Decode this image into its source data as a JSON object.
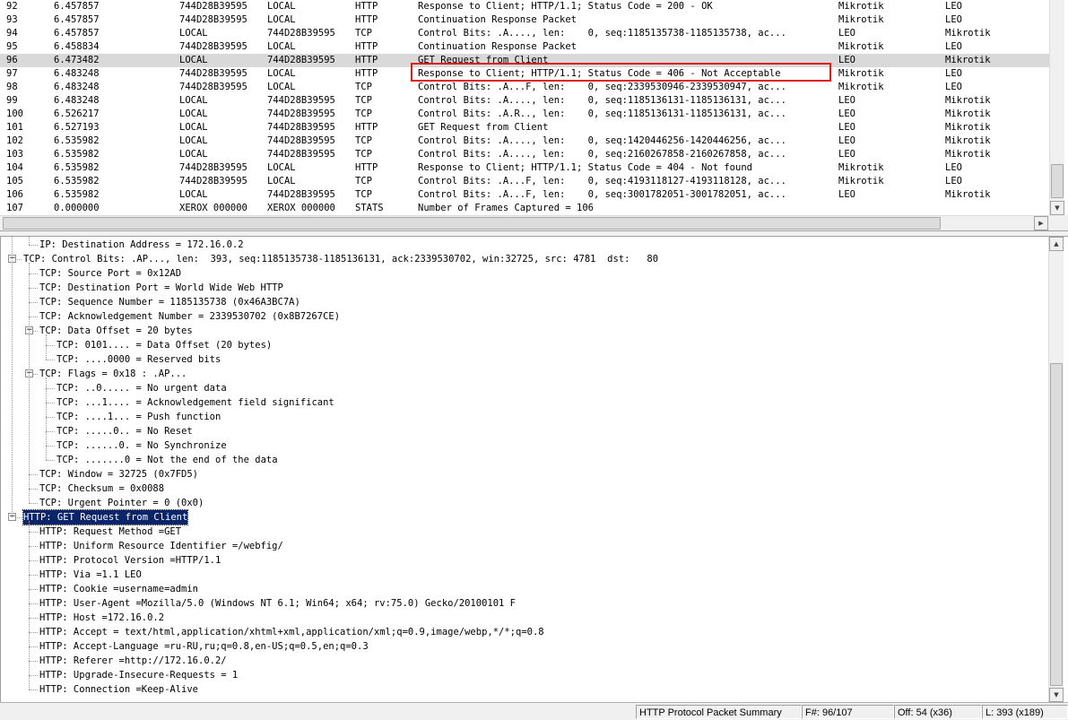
{
  "packets": [
    {
      "num": "92",
      "time": "6.457857",
      "src": "744D28B39595",
      "dst": "LOCAL",
      "protocol": "HTTP",
      "description": "Response to Client; HTTP/1.1; Status Code = 200 - OK",
      "src_other": "Mikrotik",
      "dst_other": "LEO"
    },
    {
      "num": "93",
      "time": "6.457857",
      "src": "744D28B39595",
      "dst": "LOCAL",
      "protocol": "HTTP",
      "description": "Continuation Response Packet",
      "src_other": "Mikrotik",
      "dst_other": "LEO"
    },
    {
      "num": "94",
      "time": "6.457857",
      "src": "LOCAL",
      "dst": "744D28B39595",
      "protocol": "TCP",
      "description": "Control Bits: .A...., len:    0, seq:1185135738-1185135738, ac...",
      "src_other": "LEO",
      "dst_other": "Mikrotik"
    },
    {
      "num": "95",
      "time": "6.458834",
      "src": "744D28B39595",
      "dst": "LOCAL",
      "protocol": "HTTP",
      "description": "Continuation Response Packet",
      "src_other": "Mikrotik",
      "dst_other": "LEO"
    },
    {
      "num": "96",
      "time": "6.473482",
      "src": "LOCAL",
      "dst": "744D28B39595",
      "protocol": "HTTP",
      "description": "GET Request from Client",
      "src_other": "LEO",
      "dst_other": "Mikrotik",
      "selected": true
    },
    {
      "num": "97",
      "time": "6.483248",
      "src": "744D28B39595",
      "dst": "LOCAL",
      "protocol": "HTTP",
      "description": "Response to Client; HTTP/1.1; Status Code = 406 - Not Acceptable",
      "src_other": "Mikrotik",
      "dst_other": "LEO"
    },
    {
      "num": "98",
      "time": "6.483248",
      "src": "744D28B39595",
      "dst": "LOCAL",
      "protocol": "TCP",
      "description": "Control Bits: .A...F, len:    0, seq:2339530946-2339530947, ac...",
      "src_other": "Mikrotik",
      "dst_other": "LEO"
    },
    {
      "num": "99",
      "time": "6.483248",
      "src": "LOCAL",
      "dst": "744D28B39595",
      "protocol": "TCP",
      "description": "Control Bits: .A...., len:    0, seq:1185136131-1185136131, ac...",
      "src_other": "LEO",
      "dst_other": "Mikrotik"
    },
    {
      "num": "100",
      "time": "6.526217",
      "src": "LOCAL",
      "dst": "744D28B39595",
      "protocol": "TCP",
      "description": "Control Bits: .A.R.., len:    0, seq:1185136131-1185136131, ac...",
      "src_other": "LEO",
      "dst_other": "Mikrotik"
    },
    {
      "num": "101",
      "time": "6.527193",
      "src": "LOCAL",
      "dst": "744D28B39595",
      "protocol": "HTTP",
      "description": "GET Request from Client",
      "src_other": "LEO",
      "dst_other": "Mikrotik"
    },
    {
      "num": "102",
      "time": "6.535982",
      "src": "LOCAL",
      "dst": "744D28B39595",
      "protocol": "TCP",
      "description": "Control Bits: .A...., len:    0, seq:1420446256-1420446256, ac...",
      "src_other": "LEO",
      "dst_other": "Mikrotik"
    },
    {
      "num": "103",
      "time": "6.535982",
      "src": "LOCAL",
      "dst": "744D28B39595",
      "protocol": "TCP",
      "description": "Control Bits: .A...., len:    0, seq:2160267858-2160267858, ac...",
      "src_other": "LEO",
      "dst_other": "Mikrotik"
    },
    {
      "num": "104",
      "time": "6.535982",
      "src": "744D28B39595",
      "dst": "LOCAL",
      "protocol": "HTTP",
      "description": "Response to Client; HTTP/1.1; Status Code = 404 - Not found",
      "src_other": "Mikrotik",
      "dst_other": "LEO"
    },
    {
      "num": "105",
      "time": "6.535982",
      "src": "744D28B39595",
      "dst": "LOCAL",
      "protocol": "TCP",
      "description": "Control Bits: .A...F, len:    0, seq:4193118127-4193118128, ac...",
      "src_other": "Mikrotik",
      "dst_other": "LEO"
    },
    {
      "num": "106",
      "time": "6.535982",
      "src": "LOCAL",
      "dst": "744D28B39595",
      "protocol": "TCP",
      "description": "Control Bits: .A...F, len:    0, seq:3001782051-3001782051, ac...",
      "src_other": "LEO",
      "dst_other": "Mikrotik"
    },
    {
      "num": "107",
      "time": "0.000000",
      "src": "XEROX 000000",
      "dst": "XEROX 000000",
      "protocol": "STATS",
      "description": "Number of Frames Captured = 106",
      "src_other": "",
      "dst_other": ""
    }
  ],
  "details": [
    {
      "level": 1,
      "text": "IP: Destination Address = 172.16.0.2",
      "expander": "none"
    },
    {
      "level": 0,
      "text": "TCP: Control Bits: .AP..., len:  393, seq:1185135738-1185136131, ack:2339530702, win:32725, src: 4781  dst:   80",
      "expander": "minus"
    },
    {
      "level": 1,
      "text": "TCP: Source Port = 0x12AD",
      "expander": "none"
    },
    {
      "level": 1,
      "text": "TCP: Destination Port = World Wide Web HTTP",
      "expander": "none"
    },
    {
      "level": 1,
      "text": "TCP: Sequence Number = 1185135738 (0x46A3BC7A)",
      "expander": "none"
    },
    {
      "level": 1,
      "text": "TCP: Acknowledgement Number = 2339530702 (0x8B7267CE)",
      "expander": "none"
    },
    {
      "level": 1,
      "text": "TCP: Data Offset = 20 bytes",
      "expander": "minus"
    },
    {
      "level": 2,
      "text": "TCP: 0101.... = Data Offset (20 bytes)",
      "expander": "none"
    },
    {
      "level": 2,
      "text": "TCP: ....0000 = Reserved bits",
      "expander": "none"
    },
    {
      "level": 1,
      "text": "TCP: Flags = 0x18 : .AP...",
      "expander": "minus"
    },
    {
      "level": 2,
      "text": "TCP: ..0..... = No urgent data",
      "expander": "none"
    },
    {
      "level": 2,
      "text": "TCP: ...1.... = Acknowledgement field significant",
      "expander": "none"
    },
    {
      "level": 2,
      "text": "TCP: ....1... = Push function",
      "expander": "none"
    },
    {
      "level": 2,
      "text": "TCP: .....0.. = No Reset",
      "expander": "none"
    },
    {
      "level": 2,
      "text": "TCP: ......0. = No Synchronize",
      "expander": "none"
    },
    {
      "level": 2,
      "text": "TCP: .......0 = Not the end of the data",
      "expander": "none"
    },
    {
      "level": 1,
      "text": "TCP: Window = 32725 (0x7FD5)",
      "expander": "none"
    },
    {
      "level": 1,
      "text": "TCP: Checksum = 0x0088",
      "expander": "none"
    },
    {
      "level": 1,
      "text": "TCP: Urgent Pointer = 0 (0x0)",
      "expander": "none"
    },
    {
      "level": 0,
      "text": "HTTP: GET Request from Client",
      "expander": "minus",
      "selected": true
    },
    {
      "level": 1,
      "text": "HTTP: Request Method =GET",
      "expander": "none"
    },
    {
      "level": 1,
      "text": "HTTP: Uniform Resource Identifier =/webfig/",
      "expander": "none"
    },
    {
      "level": 1,
      "text": "HTTP: Protocol Version =HTTP/1.1",
      "expander": "none"
    },
    {
      "level": 1,
      "text": "HTTP: Via =1.1 LEO",
      "expander": "none"
    },
    {
      "level": 1,
      "text": "HTTP: Cookie =username=admin",
      "expander": "none"
    },
    {
      "level": 1,
      "text": "HTTP: User-Agent =Mozilla/5.0 (Windows NT 6.1; Win64; x64; rv:75.0) Gecko/20100101 F",
      "expander": "none"
    },
    {
      "level": 1,
      "text": "HTTP: Host =172.16.0.2",
      "expander": "none"
    },
    {
      "level": 1,
      "text": "HTTP: Accept = text/html,application/xhtml+xml,application/xml;q=0.9,image/webp,*/*;q=0.8",
      "expander": "none"
    },
    {
      "level": 1,
      "text": "HTTP: Accept-Language =ru-RU,ru;q=0.8,en-US;q=0.5,en;q=0.3",
      "expander": "none"
    },
    {
      "level": 1,
      "text": "HTTP: Referer =http://172.16.0.2/",
      "expander": "none"
    },
    {
      "level": 1,
      "text": "HTTP: Upgrade-Insecure-Requests = 1",
      "expander": "none"
    },
    {
      "level": 1,
      "text": "HTTP: Connection =Keep-Alive",
      "expander": "none"
    }
  ],
  "status_bar": {
    "summary": "HTTP Protocol Packet Summary",
    "frame": "F#: 96/107",
    "offset": "Off: 54 (x36)",
    "length": "L: 393 (x189)"
  },
  "highlight_color": "#e01a1a",
  "selection_color": "#0a246a"
}
